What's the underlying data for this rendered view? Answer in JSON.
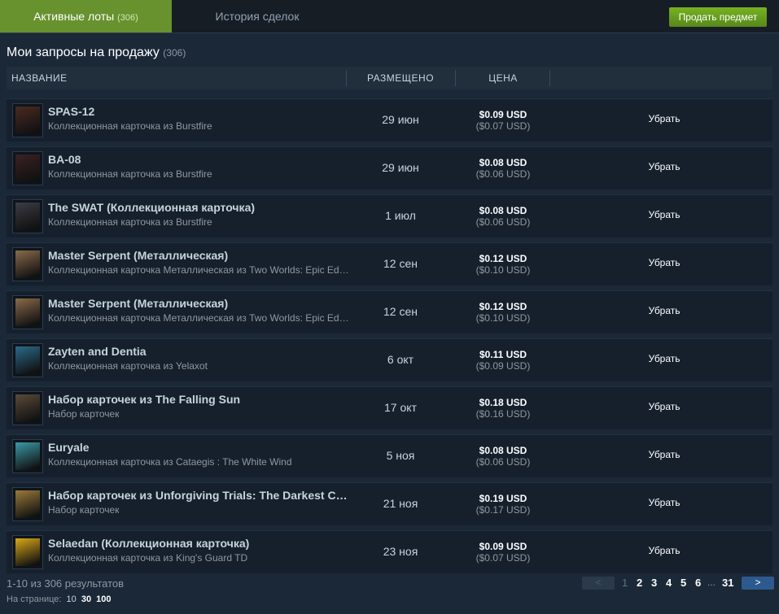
{
  "tabs": {
    "active_label": "Активные лоты",
    "active_count": "(306)",
    "history_label": "История сделок"
  },
  "sell_button": "Продать предмет",
  "section": {
    "title": "Мои запросы на продажу",
    "count": "(306)"
  },
  "columns": {
    "name": "НАЗВАНИЕ",
    "listed": "РАЗМЕЩЕНО",
    "price": "ЦЕНА"
  },
  "rows": [
    {
      "name": "SPAS-12",
      "game": "Коллекционная карточка из Burstfire",
      "date": "29 июн",
      "price": "$0.09 USD",
      "price_net": "($0.07 USD)",
      "action": "Убрать",
      "thumb_color": "#4a2a22"
    },
    {
      "name": "BA-08",
      "game": "Коллекционная карточка из Burstfire",
      "date": "29 июн",
      "price": "$0.08 USD",
      "price_net": "($0.06 USD)",
      "action": "Убрать",
      "thumb_color": "#3a2222"
    },
    {
      "name": "The SWAT (Коллекционная карточка)",
      "game": "Коллекционная карточка из Burstfire",
      "date": "1 июл",
      "price": "$0.08 USD",
      "price_net": "($0.06 USD)",
      "action": "Убрать",
      "thumb_color": "#3c3c44"
    },
    {
      "name": "Master Serpent (Металлическая)",
      "game": "Коллекционная карточка Металлическая из Two Worlds: Epic Edition",
      "date": "12 сен",
      "price": "$0.12 USD",
      "price_net": "($0.10 USD)",
      "action": "Убрать",
      "thumb_color": "#8a6a4a"
    },
    {
      "name": "Master Serpent (Металлическая)",
      "game": "Коллекционная карточка Металлическая из Two Worlds: Epic Edition",
      "date": "12 сен",
      "price": "$0.12 USD",
      "price_net": "($0.10 USD)",
      "action": "Убрать",
      "thumb_color": "#8a6a4a"
    },
    {
      "name": "Zayten and Dentia",
      "game": "Коллекционная карточка из Yelaxot",
      "date": "6 окт",
      "price": "$0.11 USD",
      "price_net": "($0.09 USD)",
      "action": "Убрать",
      "thumb_color": "#2a6a8a"
    },
    {
      "name": "Набор карточек из The Falling Sun",
      "game": "Набор карточек",
      "date": "17 окт",
      "price": "$0.18 USD",
      "price_net": "($0.16 USD)",
      "action": "Убрать",
      "thumb_color": "#5a4a3a"
    },
    {
      "name": "Euryale",
      "game": "Коллекционная карточка из Cataegis : The White Wind",
      "date": "5 ноя",
      "price": "$0.08 USD",
      "price_net": "($0.06 USD)",
      "action": "Убрать",
      "thumb_color": "#3a9aa8"
    },
    {
      "name": "Набор карточек из Unforgiving Trials: The Darkest Crime",
      "game": "Набор карточек",
      "date": "21 ноя",
      "price": "$0.19 USD",
      "price_net": "($0.17 USD)",
      "action": "Убрать",
      "thumb_color": "#9a7a3a"
    },
    {
      "name": "Selaedan (Коллекционная карточка)",
      "game": "Коллекционная карточка из King's Guard TD",
      "date": "23 ноя",
      "price": "$0.09 USD",
      "price_net": "($0.07 USD)",
      "action": "Убрать",
      "thumb_color": "#d8a818"
    }
  ],
  "footer": {
    "results": "1-10 из 306 результатов",
    "per_page_label": "На странице:",
    "per_page_options": [
      "10",
      "30",
      "100"
    ]
  },
  "pager": {
    "prev": "<",
    "next": ">",
    "pages": [
      "1",
      "2",
      "3",
      "4",
      "5",
      "6"
    ],
    "dots": "...",
    "last": "31"
  }
}
